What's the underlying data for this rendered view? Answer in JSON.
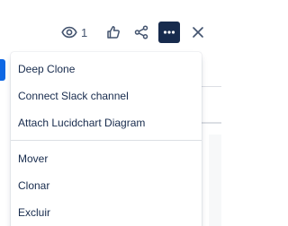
{
  "toolbar": {
    "watch_icon": "eye-icon",
    "watch_count": "1",
    "like_icon": "thumbs-up-icon",
    "share_icon": "share-icon",
    "more_icon": "more-horizontal-icon",
    "close_icon": "close-icon"
  },
  "menu": {
    "group_one": [
      {
        "label": "Deep Clone"
      },
      {
        "label": "Connect Slack channel"
      },
      {
        "label": "Attach Lucidchart Diagram"
      }
    ],
    "group_two": [
      {
        "label": "Mover"
      },
      {
        "label": "Clonar"
      },
      {
        "label": "Excluir"
      }
    ]
  },
  "colors": {
    "accent": "#0c66e4",
    "text": "#172b4d",
    "icon": "#44546f",
    "active_button": "#172b4d"
  }
}
